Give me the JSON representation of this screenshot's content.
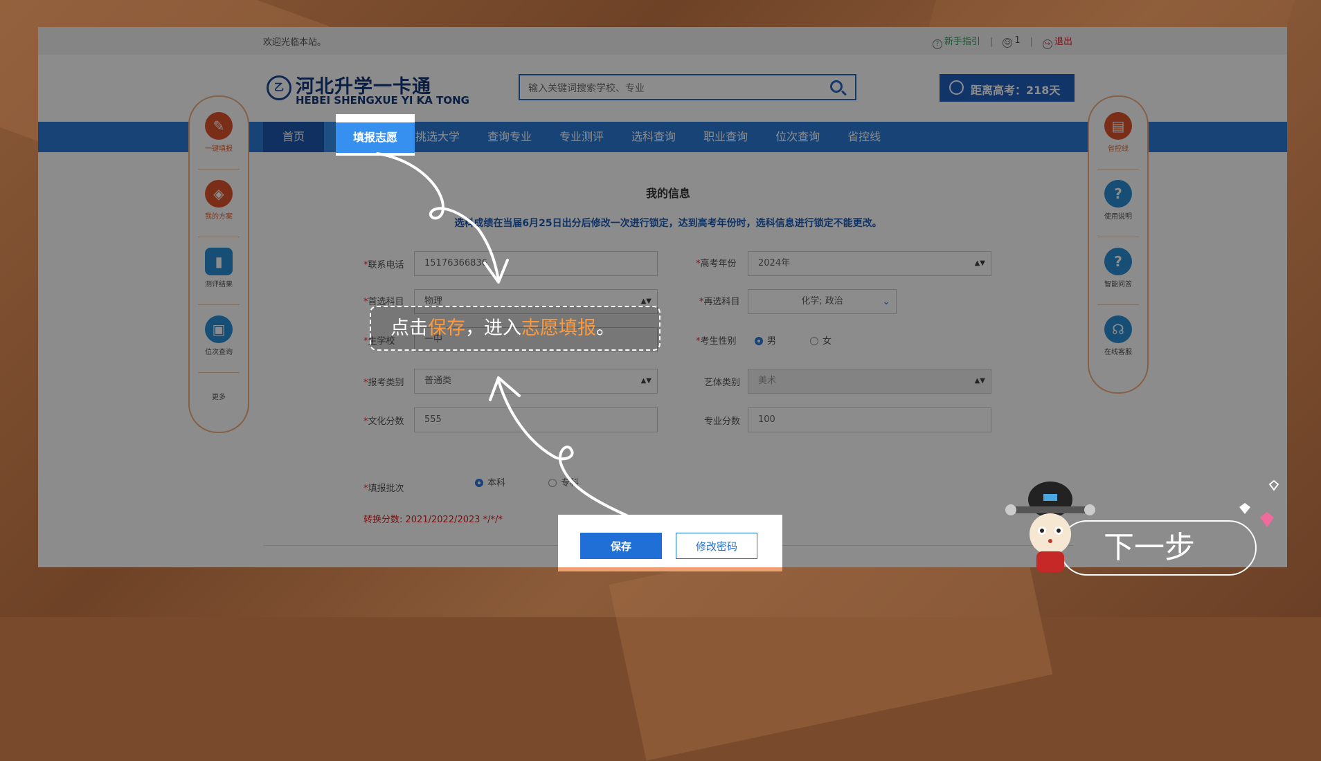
{
  "topbar": {
    "welcome": "欢迎光临本站。",
    "guide": "新手指引",
    "user": "1",
    "logout": "退出"
  },
  "logo": {
    "cn": "河北升学一卡通",
    "en": "HEBEI SHENGXUE YI KA TONG"
  },
  "search": {
    "placeholder": "输入关键词搜索学校、专业"
  },
  "countdown": "距离高考：218天",
  "nav": {
    "items": [
      "首页",
      "填报志愿",
      "挑选大学",
      "查询专业",
      "专业测评",
      "选科查询",
      "职业查询",
      "位次查询",
      "省控线"
    ]
  },
  "form": {
    "title": "我的信息",
    "notice": "选科成绩在当届6月25日出分后修改一次进行锁定，达到高考年份时，选科信息进行锁定不能更改。",
    "phone_label": "联系电话",
    "phone_value": "15176366836",
    "year_label": "高考年份",
    "year_value": "2024年",
    "first_subject_label": "首选科目",
    "first_subject_value": "物理",
    "second_subject_label": "再选科目",
    "second_subject_value": "化学; 政治",
    "school_label": "生学校",
    "school_value": "一中",
    "gender_label": "考生性别",
    "gender_male": "男",
    "gender_female": "女",
    "category_label": "报考类别",
    "category_value": "普通类",
    "art_label": "艺体类别",
    "art_value": "美术",
    "culture_label": "文化分数",
    "culture_value": "555",
    "pro_label": "专业分数",
    "pro_value": "100",
    "batch_label": "填报批次",
    "batch_ben": "本科",
    "batch_zhuan": "专科",
    "convert": "转换分数: 2021/2022/2023    */*/*"
  },
  "sidebar_left": [
    {
      "label": "一键填报",
      "icon": "one-click-fill-icon"
    },
    {
      "label": "我的方案",
      "icon": "layers-icon"
    },
    {
      "label": "测评结果",
      "icon": "bar-chart-icon"
    },
    {
      "label": "位次查询",
      "icon": "rank-icon"
    },
    {
      "label": "更多",
      "icon": ""
    }
  ],
  "sidebar_right": [
    {
      "label": "省控线",
      "icon": "chart-icon"
    },
    {
      "label": "使用说明",
      "icon": "help-icon"
    },
    {
      "label": "智能问答",
      "icon": "chat-icon"
    },
    {
      "label": "在线客服",
      "icon": "headset-icon"
    }
  ],
  "buttons": {
    "save": "保存",
    "change_password": "修改密码"
  },
  "tip": {
    "pre": "点击",
    "hl1": "保存",
    "mid": "，进入",
    "hl2": "志愿填报",
    "post": "。"
  },
  "next": "下一步",
  "colors": {
    "primary": "#2d7ad8",
    "accent": "#ff9a3c",
    "sidebar_border": "#f0b080"
  }
}
